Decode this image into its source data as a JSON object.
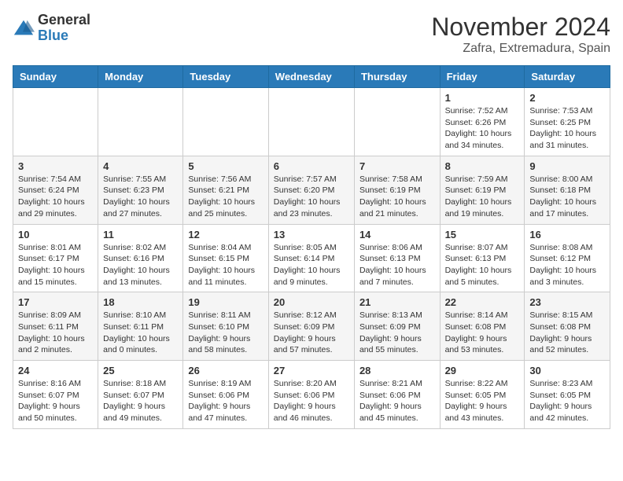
{
  "logo": {
    "general": "General",
    "blue": "Blue"
  },
  "title": "November 2024",
  "location": "Zafra, Extremadura, Spain",
  "days_header": [
    "Sunday",
    "Monday",
    "Tuesday",
    "Wednesday",
    "Thursday",
    "Friday",
    "Saturday"
  ],
  "weeks": [
    [
      {
        "day": "",
        "info": ""
      },
      {
        "day": "",
        "info": ""
      },
      {
        "day": "",
        "info": ""
      },
      {
        "day": "",
        "info": ""
      },
      {
        "day": "",
        "info": ""
      },
      {
        "day": "1",
        "info": "Sunrise: 7:52 AM\nSunset: 6:26 PM\nDaylight: 10 hours and 34 minutes."
      },
      {
        "day": "2",
        "info": "Sunrise: 7:53 AM\nSunset: 6:25 PM\nDaylight: 10 hours and 31 minutes."
      }
    ],
    [
      {
        "day": "3",
        "info": "Sunrise: 7:54 AM\nSunset: 6:24 PM\nDaylight: 10 hours and 29 minutes."
      },
      {
        "day": "4",
        "info": "Sunrise: 7:55 AM\nSunset: 6:23 PM\nDaylight: 10 hours and 27 minutes."
      },
      {
        "day": "5",
        "info": "Sunrise: 7:56 AM\nSunset: 6:21 PM\nDaylight: 10 hours and 25 minutes."
      },
      {
        "day": "6",
        "info": "Sunrise: 7:57 AM\nSunset: 6:20 PM\nDaylight: 10 hours and 23 minutes."
      },
      {
        "day": "7",
        "info": "Sunrise: 7:58 AM\nSunset: 6:19 PM\nDaylight: 10 hours and 21 minutes."
      },
      {
        "day": "8",
        "info": "Sunrise: 7:59 AM\nSunset: 6:19 PM\nDaylight: 10 hours and 19 minutes."
      },
      {
        "day": "9",
        "info": "Sunrise: 8:00 AM\nSunset: 6:18 PM\nDaylight: 10 hours and 17 minutes."
      }
    ],
    [
      {
        "day": "10",
        "info": "Sunrise: 8:01 AM\nSunset: 6:17 PM\nDaylight: 10 hours and 15 minutes."
      },
      {
        "day": "11",
        "info": "Sunrise: 8:02 AM\nSunset: 6:16 PM\nDaylight: 10 hours and 13 minutes."
      },
      {
        "day": "12",
        "info": "Sunrise: 8:04 AM\nSunset: 6:15 PM\nDaylight: 10 hours and 11 minutes."
      },
      {
        "day": "13",
        "info": "Sunrise: 8:05 AM\nSunset: 6:14 PM\nDaylight: 10 hours and 9 minutes."
      },
      {
        "day": "14",
        "info": "Sunrise: 8:06 AM\nSunset: 6:13 PM\nDaylight: 10 hours and 7 minutes."
      },
      {
        "day": "15",
        "info": "Sunrise: 8:07 AM\nSunset: 6:13 PM\nDaylight: 10 hours and 5 minutes."
      },
      {
        "day": "16",
        "info": "Sunrise: 8:08 AM\nSunset: 6:12 PM\nDaylight: 10 hours and 3 minutes."
      }
    ],
    [
      {
        "day": "17",
        "info": "Sunrise: 8:09 AM\nSunset: 6:11 PM\nDaylight: 10 hours and 2 minutes."
      },
      {
        "day": "18",
        "info": "Sunrise: 8:10 AM\nSunset: 6:11 PM\nDaylight: 10 hours and 0 minutes."
      },
      {
        "day": "19",
        "info": "Sunrise: 8:11 AM\nSunset: 6:10 PM\nDaylight: 9 hours and 58 minutes."
      },
      {
        "day": "20",
        "info": "Sunrise: 8:12 AM\nSunset: 6:09 PM\nDaylight: 9 hours and 57 minutes."
      },
      {
        "day": "21",
        "info": "Sunrise: 8:13 AM\nSunset: 6:09 PM\nDaylight: 9 hours and 55 minutes."
      },
      {
        "day": "22",
        "info": "Sunrise: 8:14 AM\nSunset: 6:08 PM\nDaylight: 9 hours and 53 minutes."
      },
      {
        "day": "23",
        "info": "Sunrise: 8:15 AM\nSunset: 6:08 PM\nDaylight: 9 hours and 52 minutes."
      }
    ],
    [
      {
        "day": "24",
        "info": "Sunrise: 8:16 AM\nSunset: 6:07 PM\nDaylight: 9 hours and 50 minutes."
      },
      {
        "day": "25",
        "info": "Sunrise: 8:18 AM\nSunset: 6:07 PM\nDaylight: 9 hours and 49 minutes."
      },
      {
        "day": "26",
        "info": "Sunrise: 8:19 AM\nSunset: 6:06 PM\nDaylight: 9 hours and 47 minutes."
      },
      {
        "day": "27",
        "info": "Sunrise: 8:20 AM\nSunset: 6:06 PM\nDaylight: 9 hours and 46 minutes."
      },
      {
        "day": "28",
        "info": "Sunrise: 8:21 AM\nSunset: 6:06 PM\nDaylight: 9 hours and 45 minutes."
      },
      {
        "day": "29",
        "info": "Sunrise: 8:22 AM\nSunset: 6:05 PM\nDaylight: 9 hours and 43 minutes."
      },
      {
        "day": "30",
        "info": "Sunrise: 8:23 AM\nSunset: 6:05 PM\nDaylight: 9 hours and 42 minutes."
      }
    ]
  ]
}
